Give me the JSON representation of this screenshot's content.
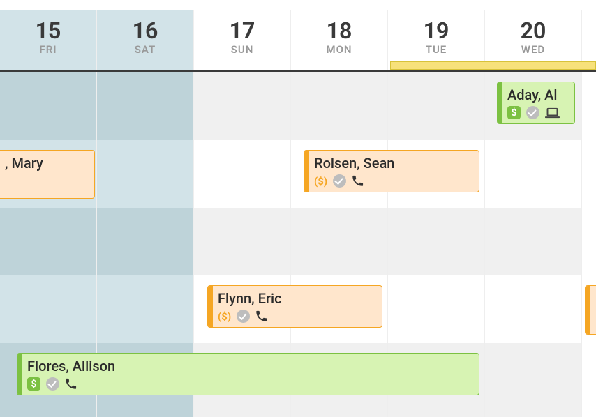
{
  "header": {
    "days": [
      {
        "num": "15",
        "dow": "FRI",
        "weekend": true
      },
      {
        "num": "16",
        "dow": "SAT",
        "weekend": true
      },
      {
        "num": "17",
        "dow": "SUN",
        "weekend": false
      },
      {
        "num": "18",
        "dow": "MON",
        "weekend": false
      },
      {
        "num": "19",
        "dow": "TUE",
        "weekend": false
      },
      {
        "num": "20",
        "dow": "WED",
        "weekend": false
      }
    ]
  },
  "events": {
    "aday": {
      "name": "Aday, Al",
      "type": "green",
      "pay": "paid",
      "checked": true,
      "symbol": "laptop"
    },
    "mary": {
      "name": ", Mary",
      "type": "orange",
      "pay": "",
      "checked": false,
      "symbol": ""
    },
    "rolsen": {
      "name": "Rolsen, Sean",
      "type": "orange",
      "pay": "pending",
      "checked": true,
      "symbol": "phone"
    },
    "flynn": {
      "name": "Flynn, Eric",
      "type": "orange",
      "pay": "pending",
      "checked": true,
      "symbol": "phone"
    },
    "flores": {
      "name": "Flores, Allison",
      "type": "green",
      "pay": "paid",
      "checked": true,
      "symbol": "phone"
    }
  },
  "labels": {
    "pay_pending": "($)",
    "pay_paid": "$"
  },
  "colors": {
    "orange_border": "#f5a623",
    "orange_fill": "#ffe6cc",
    "green_border": "#7cc142",
    "green_fill": "#d7f3b3",
    "weekend_fill": "#d2e3e8"
  }
}
